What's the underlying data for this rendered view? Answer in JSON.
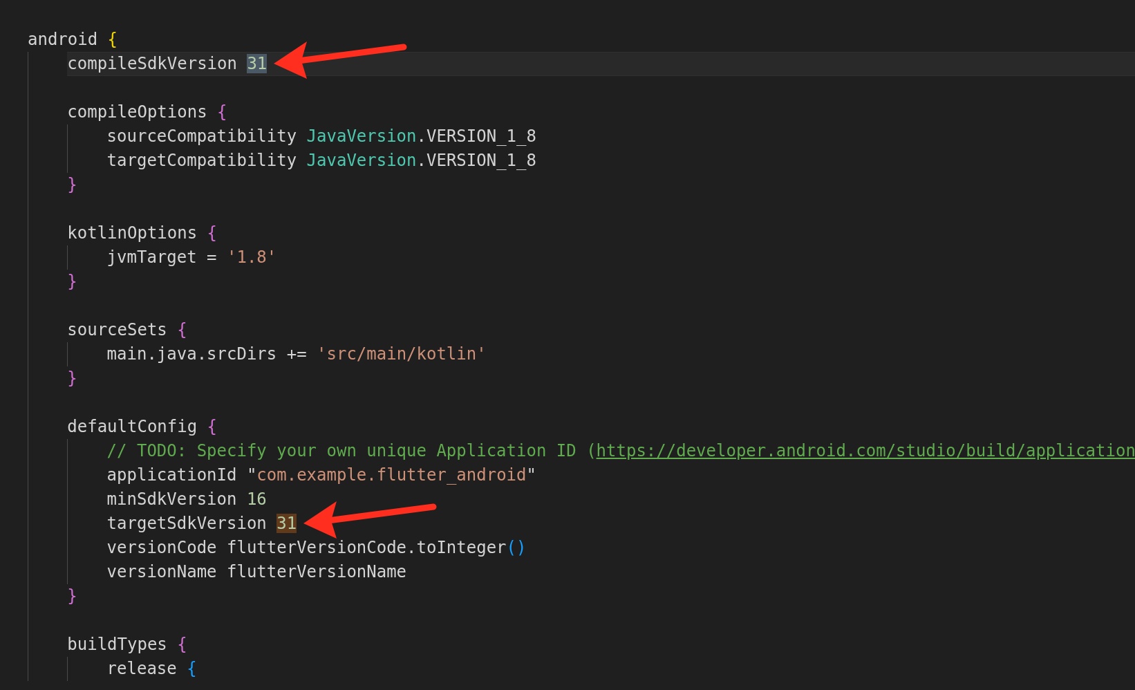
{
  "editor": {
    "lines": [
      {
        "kind": "code",
        "current": false,
        "tokens": [
          {
            "text": "android ",
            "kind": "plain"
          },
          {
            "text": "{",
            "kind": "brace-outer"
          }
        ],
        "children": [
          {
            "kind": "code",
            "current": true,
            "tokens": [
              {
                "text": "compileSdkVersion ",
                "kind": "plain"
              },
              {
                "text": "31",
                "kind": "selected-number",
                "arrow": true
              }
            ]
          },
          {
            "kind": "blank"
          },
          {
            "kind": "code",
            "current": false,
            "tokens": [
              {
                "text": "compileOptions ",
                "kind": "plain"
              },
              {
                "text": "{",
                "kind": "brace"
              }
            ],
            "children": [
              {
                "kind": "code",
                "current": false,
                "tokens": [
                  {
                    "text": "sourceCompatibility ",
                    "kind": "plain"
                  },
                  {
                    "text": "JavaVersion",
                    "kind": "type"
                  },
                  {
                    "text": ".VERSION_1_8",
                    "kind": "plain"
                  }
                ]
              },
              {
                "kind": "code",
                "current": false,
                "tokens": [
                  {
                    "text": "targetCompatibility ",
                    "kind": "plain"
                  },
                  {
                    "text": "JavaVersion",
                    "kind": "type"
                  },
                  {
                    "text": ".VERSION_1_8",
                    "kind": "plain"
                  }
                ]
              }
            ],
            "closing": [
              {
                "text": "}",
                "kind": "brace"
              }
            ]
          },
          {
            "kind": "blank"
          },
          {
            "kind": "code",
            "current": false,
            "tokens": [
              {
                "text": "kotlinOptions ",
                "kind": "plain"
              },
              {
                "text": "{",
                "kind": "brace"
              }
            ],
            "children": [
              {
                "kind": "code",
                "current": false,
                "tokens": [
                  {
                    "text": "jvmTarget = ",
                    "kind": "plain"
                  },
                  {
                    "text": "'1.8'",
                    "kind": "string"
                  }
                ]
              }
            ],
            "closing": [
              {
                "text": "}",
                "kind": "brace"
              }
            ]
          },
          {
            "kind": "blank"
          },
          {
            "kind": "code",
            "current": false,
            "tokens": [
              {
                "text": "sourceSets ",
                "kind": "plain"
              },
              {
                "text": "{",
                "kind": "brace"
              }
            ],
            "children": [
              {
                "kind": "code",
                "current": false,
                "tokens": [
                  {
                    "text": "main.java.srcDirs += ",
                    "kind": "plain"
                  },
                  {
                    "text": "'src/main/kotlin'",
                    "kind": "string"
                  }
                ]
              }
            ],
            "closing": [
              {
                "text": "}",
                "kind": "brace"
              }
            ]
          },
          {
            "kind": "blank"
          },
          {
            "kind": "code",
            "current": false,
            "tokens": [
              {
                "text": "defaultConfig ",
                "kind": "plain"
              },
              {
                "text": "{",
                "kind": "brace"
              }
            ],
            "children": [
              {
                "kind": "code",
                "current": false,
                "tokens": [
                  {
                    "text": "// TODO: Specify your own unique Application ID (",
                    "kind": "comment"
                  },
                  {
                    "text": "https://developer.android.com/studio/build/application",
                    "kind": "link"
                  }
                ]
              },
              {
                "kind": "code",
                "current": false,
                "tokens": [
                  {
                    "text": "applicationId \"",
                    "kind": "plain"
                  },
                  {
                    "text": "com.example.flutter_android",
                    "kind": "string"
                  },
                  {
                    "text": "\"",
                    "kind": "plain"
                  }
                ]
              },
              {
                "kind": "code",
                "current": false,
                "tokens": [
                  {
                    "text": "minSdkVersion ",
                    "kind": "plain"
                  },
                  {
                    "text": "16",
                    "kind": "number"
                  }
                ]
              },
              {
                "kind": "code",
                "current": false,
                "tokens": [
                  {
                    "text": "targetSdkVersion ",
                    "kind": "plain"
                  },
                  {
                    "text": "31",
                    "kind": "matched-number",
                    "arrow": true
                  }
                ]
              },
              {
                "kind": "code",
                "current": false,
                "tokens": [
                  {
                    "text": "versionCode flutterVersionCode.toInteger",
                    "kind": "plain"
                  },
                  {
                    "text": "()",
                    "kind": "paren"
                  }
                ]
              },
              {
                "kind": "code",
                "current": false,
                "tokens": [
                  {
                    "text": "versionName flutterVersionName",
                    "kind": "plain"
                  }
                ]
              }
            ],
            "closing": [
              {
                "text": "}",
                "kind": "brace"
              }
            ]
          },
          {
            "kind": "blank"
          },
          {
            "kind": "code",
            "current": false,
            "tokens": [
              {
                "text": "buildTypes ",
                "kind": "plain"
              },
              {
                "text": "{",
                "kind": "brace"
              }
            ],
            "children": [
              {
                "kind": "code",
                "current": false,
                "tokens": [
                  {
                    "text": "release ",
                    "kind": "plain"
                  },
                  {
                    "text": "{",
                    "kind": "paren"
                  }
                ]
              }
            ]
          }
        ]
      }
    ]
  }
}
